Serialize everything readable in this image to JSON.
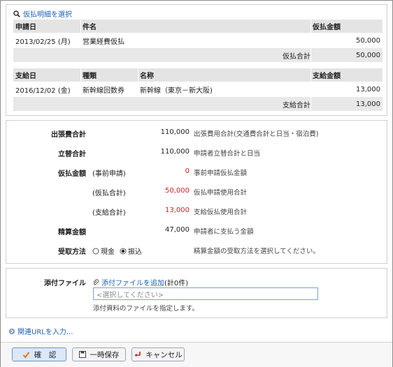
{
  "advance": {
    "select_link": "仮払明細を選択",
    "headers": [
      "申請日",
      "件名",
      "仮払金額"
    ],
    "row": {
      "date": "2013/02/25 (月)",
      "subject": "営業経費仮払",
      "amount": "50,000"
    },
    "total_label": "仮払合計",
    "total_value": "50,000"
  },
  "payment": {
    "headers": [
      "支給日",
      "種類",
      "名称",
      "支給金額"
    ],
    "row": {
      "date": "2016/12/02 (金)",
      "type": "新幹線回数券",
      "name": "新幹線（東京－新大阪)",
      "amount": "13,000"
    },
    "total_label": "支給合計",
    "total_value": "13,000"
  },
  "summary": {
    "trip_total": {
      "label": "出張費合計",
      "value": "110,000",
      "desc": "出張費用合計(交通費合計と日当・宿泊費)"
    },
    "advance_total": {
      "label": "立替合計",
      "value": "110,000",
      "desc": "申請者立替合計と日当"
    },
    "prepaid": {
      "label": "仮払金額",
      "pre_label": "(事前申請)",
      "pre_value": "0",
      "pre_desc": "事前申請仮払金額",
      "adv_label": "(仮払合計)",
      "adv_value": "50,000",
      "adv_desc": "仮払申請使用合計",
      "pay_label": "(支給合計)",
      "pay_value": "13,000",
      "pay_desc": "支給仮払使用合計"
    },
    "settlement": {
      "label": "精算金額",
      "value": "47,000",
      "desc": "申請者に支払う金額"
    },
    "receipt": {
      "label": "受取方法",
      "option_cash": "現金",
      "option_transfer": "振込",
      "selected": "振込",
      "desc": "精算金額の受取方法を選択してください。"
    }
  },
  "attachment": {
    "label": "添付ファイル",
    "add_link": "添付ファイルを追加",
    "count": "(計0件)",
    "placeholder": "<選択してください>",
    "hint": "添付資料のファイルを指定します。"
  },
  "related_url": {
    "link": "関連URLを入力..."
  },
  "buttons": {
    "confirm": "確　認",
    "save": "一時保存",
    "cancel": "キャンセル"
  },
  "colors": {
    "link": "#1d5fb8",
    "negative": "#d42020",
    "header_bg": "#e4e4e4"
  }
}
